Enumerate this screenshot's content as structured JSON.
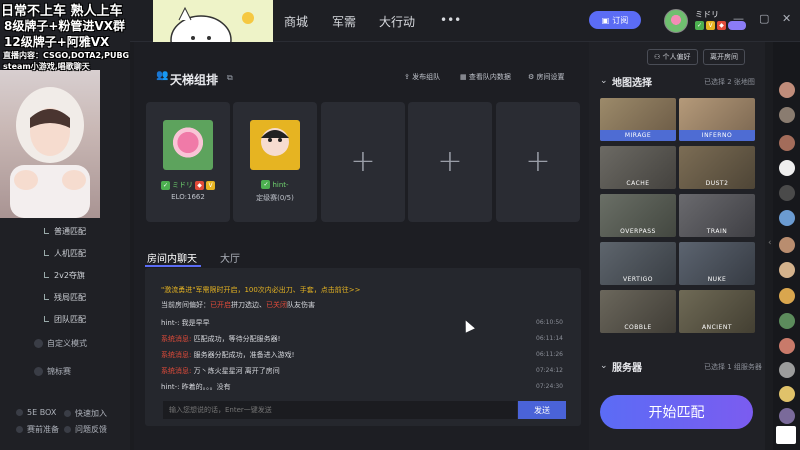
{
  "overlay": {
    "line1": "日常不上车 熟人上车",
    "line2": "8级牌子+粉管进VX群",
    "line3": "12级牌子+阿雅VX",
    "line4": "直播内容：CSGO,DOTA2,PUBG",
    "line5": "steam小游戏,唱歌聊天"
  },
  "nav": {
    "shop": "商城",
    "armory": "军需",
    "operation": "大行动",
    "more": "•••"
  },
  "topbar": {
    "subscribe": "订阅",
    "username": "ミドリ"
  },
  "sidebar": {
    "items": [
      "普通匹配",
      "人机匹配",
      "2v2夺旗",
      "残局匹配",
      "团队匹配"
    ],
    "custom_mode": "自定义模式",
    "tournament": "锦标赛",
    "se_box": "5E BOX",
    "quick_join": "快速加入",
    "match_prep": "赛前准备",
    "feedback": "问题反馈"
  },
  "lobby": {
    "title": "天梯组排",
    "actions": {
      "publish": "发布组队",
      "team_data": "查看队内数据",
      "room_settings": "房间设置"
    },
    "members": [
      {
        "name": "ミドリ",
        "elo": "ELO:1662"
      },
      {
        "name": "hint-",
        "elo": "定级赛(0/5)"
      }
    ],
    "empty_slot": "+"
  },
  "chat": {
    "tab_room": "房间内聊天",
    "tab_hall": "大厅",
    "banner": "\"激流勇进\"军需限时开启，100次内必出刀、手套，点击前往>>",
    "preference_prefix": "当前房间偏好：",
    "preference_on": "已开启",
    "preference_mid": "拼刀选边、",
    "preference_off": "已关闭",
    "preference_suffix": "队友伤害",
    "messages": [
      {
        "who": "hint-:",
        "text": " 我是早早",
        "time": "06:10:50"
      },
      {
        "who": "系统消息:",
        "text": " 匹配成功，等待分配服务器!",
        "time": "06:11:14"
      },
      {
        "who": "系统消息:",
        "text": " 服务器分配成功，准备进入游戏!",
        "time": "06:11:26"
      },
      {
        "who": "系统消息:",
        "text": " 万丶炼火星星河 离开了房间",
        "time": "07:24:12"
      },
      {
        "who": "hint-:",
        "text": " 昨着的。。。没有",
        "time": "07:24:30"
      }
    ],
    "input_placeholder": "输入您想说的话，Enter一键发送",
    "send": "发送"
  },
  "right": {
    "personal_pref": "个人偏好",
    "leave_room": "离开房间",
    "map_section": "地图选择",
    "map_meta": "已选择 2 张地图",
    "maps": [
      "MIRAGE",
      "INFERNO",
      "CACHE",
      "DUST2",
      "OVERPASS",
      "TRAIN",
      "VERTIGO",
      "NUKE",
      "COBBLE",
      "ANCIENT"
    ],
    "server_section": "服务器",
    "server_meta": "已选择 1 组服务器",
    "start": "开始匹配"
  },
  "colors": {
    "accent": "#5b6cf5",
    "green": "#4caf50",
    "red": "#e04b3a",
    "gold": "#e6b422"
  }
}
